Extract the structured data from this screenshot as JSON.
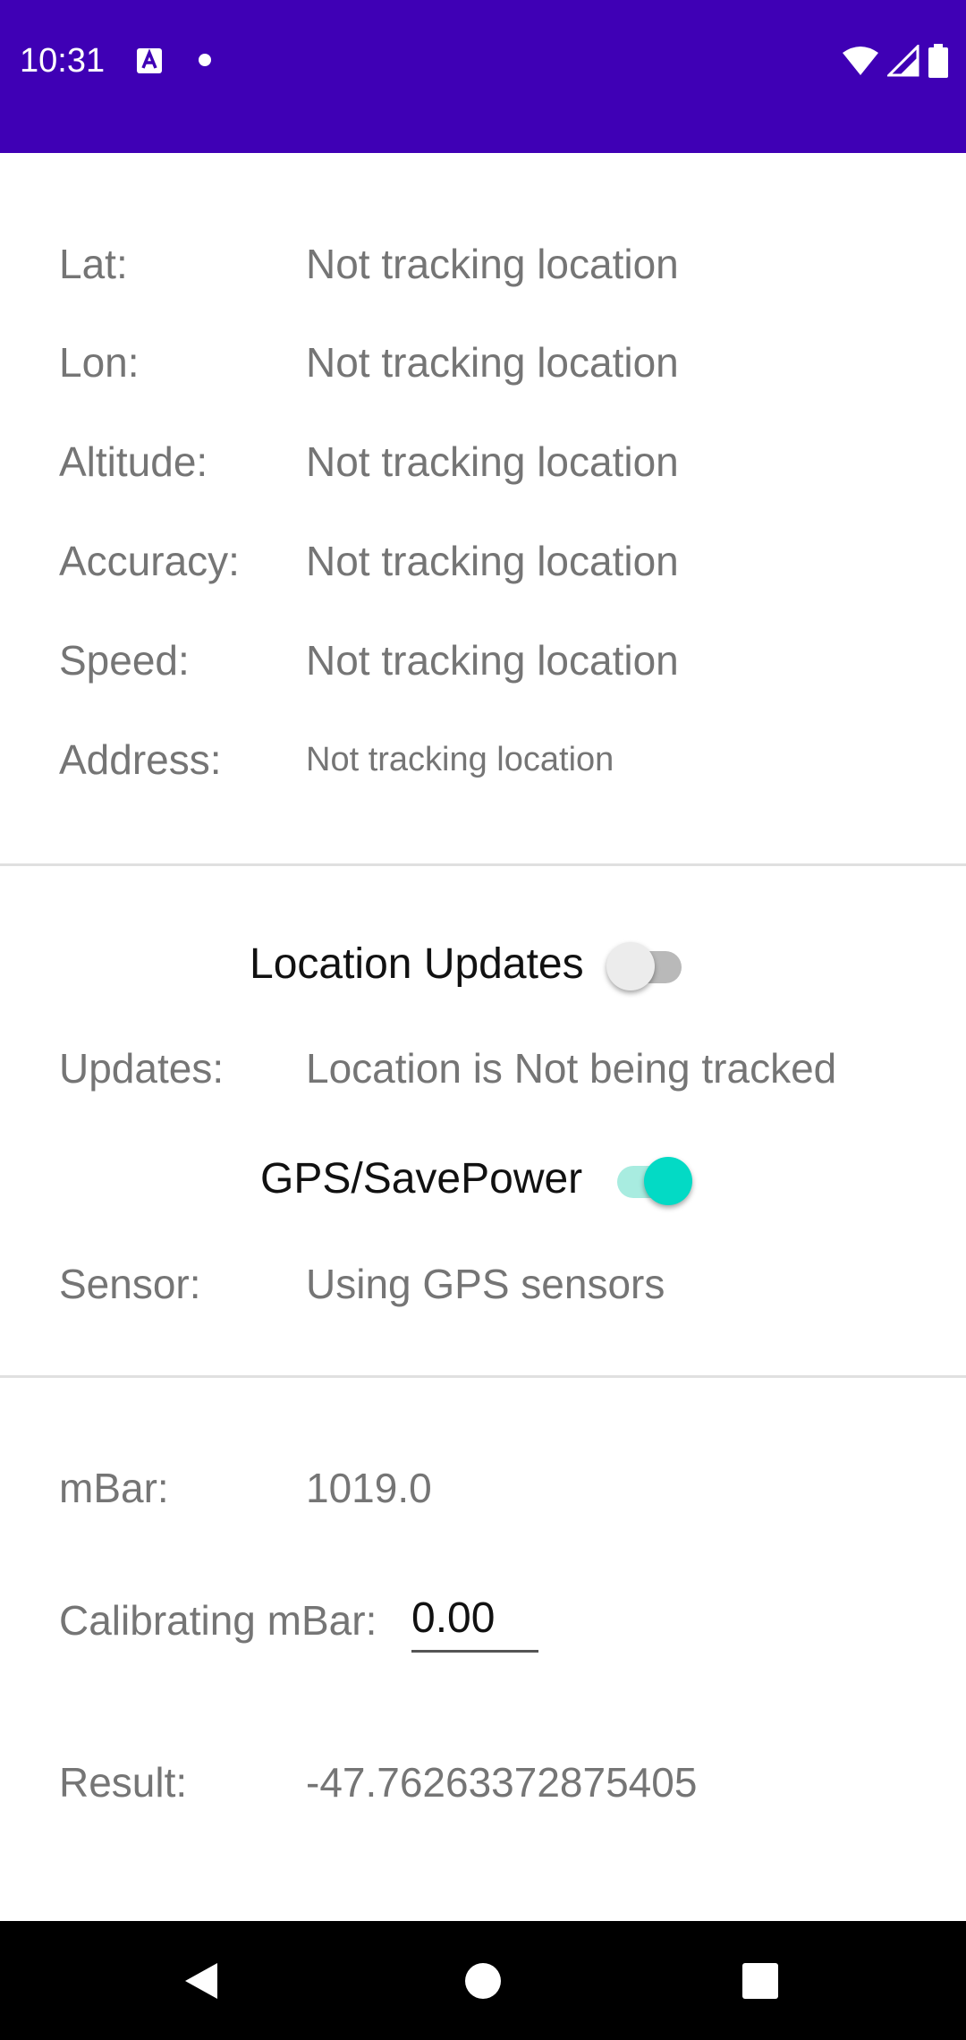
{
  "status_bar": {
    "time": "10:31",
    "background": "#3f00b5",
    "icons": [
      "keyboard-a-icon",
      "notification-dot-icon",
      "wifi-icon",
      "cell-signal-icon",
      "battery-icon"
    ]
  },
  "location": {
    "rows": [
      {
        "label": "Lat:",
        "value": "Not tracking location"
      },
      {
        "label": "Lon:",
        "value": "Not tracking location"
      },
      {
        "label": "Altitude:",
        "value": "Not tracking location"
      },
      {
        "label": "Accuracy:",
        "value": "Not tracking location"
      },
      {
        "label": "Speed:",
        "value": "Not tracking location"
      },
      {
        "label": "Address:",
        "value": "Not tracking location"
      }
    ]
  },
  "controls": {
    "location_updates": {
      "label": "Location Updates",
      "checked": false
    },
    "updates": {
      "label": "Updates:",
      "value": "Location is Not being tracked"
    },
    "gps_savepower": {
      "label": "GPS/SavePower",
      "checked": true
    },
    "sensor": {
      "label": "Sensor:",
      "value": "Using GPS sensors"
    }
  },
  "barometer": {
    "mbar": {
      "label": "mBar:",
      "value": "1019.0"
    },
    "calibrating": {
      "label": "Calibrating mBar:",
      "value": "0.00"
    },
    "result": {
      "label": "Result:",
      "value": "-47.76263372875405"
    }
  },
  "colors": {
    "accent": "#03dac5",
    "primary": "#3f00b5"
  }
}
